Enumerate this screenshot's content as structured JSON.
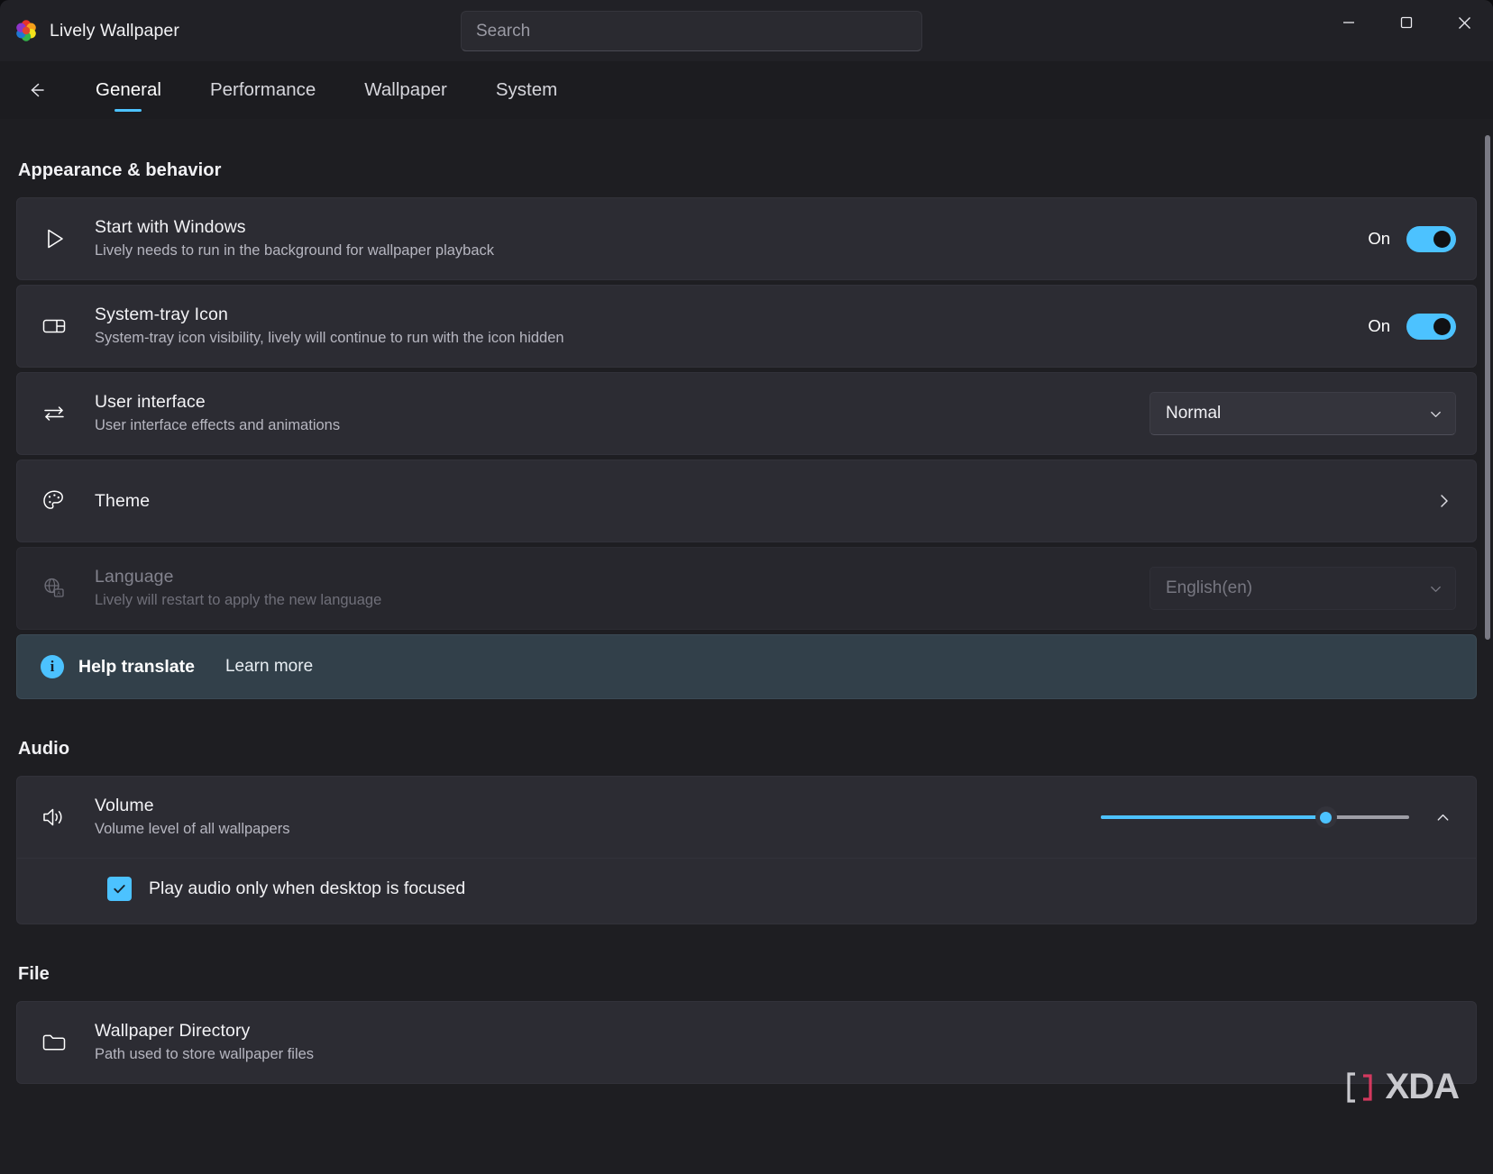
{
  "window": {
    "app_title": "Lively Wallpaper",
    "logo_icon": "lively-flower-logo",
    "controls": {
      "minimize": "minimize-icon",
      "maximize": "maximize-icon",
      "close": "close-icon"
    }
  },
  "search": {
    "placeholder": "Search",
    "value": "",
    "icon": "search-icon"
  },
  "nav": {
    "back_icon": "back-arrow-icon",
    "tabs": [
      {
        "label": "General",
        "active": true
      },
      {
        "label": "Performance",
        "active": false
      },
      {
        "label": "Wallpaper",
        "active": false
      },
      {
        "label": "System",
        "active": false
      }
    ]
  },
  "sections": {
    "appearance": {
      "heading": "Appearance & behavior",
      "rows": {
        "start_with_windows": {
          "icon": "play-triangle-icon",
          "title": "Start with Windows",
          "subtitle": "Lively needs to run in the background for wallpaper playback",
          "toggle_label": "On",
          "toggle_state": "on"
        },
        "system_tray": {
          "icon": "system-tray-panel-icon",
          "title": "System-tray Icon",
          "subtitle": "System-tray icon visibility, lively will continue to run with the icon hidden",
          "toggle_label": "On",
          "toggle_state": "on"
        },
        "user_interface": {
          "icon": "swap-arrows-icon",
          "title": "User interface",
          "subtitle": "User interface effects and animations",
          "combo_value": "Normal",
          "combo_icon": "chevron-down-icon"
        },
        "theme": {
          "icon": "palette-icon",
          "title": "Theme",
          "subtitle": "",
          "chevron_icon": "chevron-right-icon"
        },
        "language": {
          "icon": "globe-language-icon",
          "title": "Language",
          "subtitle": "Lively will restart to apply the new language",
          "combo_value": "English(en)",
          "combo_icon": "chevron-down-icon",
          "disabled": true
        }
      },
      "info_banner": {
        "icon": "info-icon",
        "title": "Help translate",
        "link_label": "Learn more"
      }
    },
    "audio": {
      "heading": "Audio",
      "volume": {
        "icon": "speaker-volume-icon",
        "title": "Volume",
        "subtitle": "Volume level of all wallpapers",
        "value": 73,
        "min": 0,
        "max": 100,
        "expander_icon": "chevron-up-icon"
      },
      "checkbox": {
        "label": "Play audio only when desktop is focused",
        "checked": true,
        "icon": "checkmark-icon"
      }
    },
    "file": {
      "heading": "File",
      "wallpaper_directory": {
        "icon": "folder-icon",
        "title": "Wallpaper Directory",
        "subtitle": "Path used to store wallpaper files"
      }
    }
  },
  "watermark": {
    "text": "XDA"
  },
  "colors": {
    "accent": "#4cc2ff",
    "window_bg": "#1e1e22",
    "card_bg": "#2c2c33",
    "info_bg": "#32404a"
  }
}
